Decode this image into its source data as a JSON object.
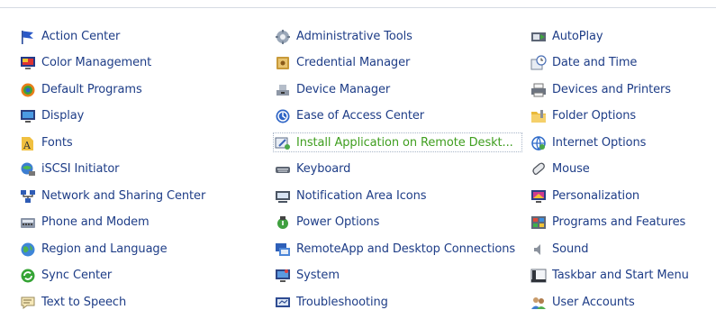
{
  "top_border_color": "#d6dbe3",
  "columns": [
    {
      "items": [
        {
          "label": "Action Center",
          "icon": "flag-icon"
        },
        {
          "label": "Color Management",
          "icon": "monitor-color-icon"
        },
        {
          "label": "Default Programs",
          "icon": "default-programs-icon"
        },
        {
          "label": "Display",
          "icon": "display-icon"
        },
        {
          "label": "Fonts",
          "icon": "fonts-icon"
        },
        {
          "label": "iSCSI Initiator",
          "icon": "iscsi-icon"
        },
        {
          "label": "Network and Sharing Center",
          "icon": "network-icon"
        },
        {
          "label": "Phone and Modem",
          "icon": "phone-modem-icon"
        },
        {
          "label": "Region and Language",
          "icon": "globe-icon"
        },
        {
          "label": "Sync Center",
          "icon": "sync-icon"
        },
        {
          "label": "Text to Speech",
          "icon": "speech-icon"
        }
      ]
    },
    {
      "items": [
        {
          "label": "Administrative Tools",
          "icon": "admin-tools-icon"
        },
        {
          "label": "Credential Manager",
          "icon": "credential-icon"
        },
        {
          "label": "Device Manager",
          "icon": "device-manager-icon"
        },
        {
          "label": "Ease of Access Center",
          "icon": "ease-of-access-icon"
        },
        {
          "label": "Install Application on Remote Deskt...",
          "icon": "install-app-icon",
          "selected": true
        },
        {
          "label": "Keyboard",
          "icon": "keyboard-icon"
        },
        {
          "label": "Notification Area Icons",
          "icon": "notification-icon"
        },
        {
          "label": "Power Options",
          "icon": "power-icon"
        },
        {
          "label": "RemoteApp and Desktop Connections",
          "icon": "remoteapp-icon"
        },
        {
          "label": "System",
          "icon": "system-icon"
        },
        {
          "label": "Troubleshooting",
          "icon": "troubleshooting-icon"
        }
      ]
    },
    {
      "items": [
        {
          "label": "AutoPlay",
          "icon": "autoplay-icon"
        },
        {
          "label": "Date and Time",
          "icon": "clock-icon"
        },
        {
          "label": "Devices and Printers",
          "icon": "printer-icon"
        },
        {
          "label": "Folder Options",
          "icon": "folder-icon"
        },
        {
          "label": "Internet Options",
          "icon": "internet-icon"
        },
        {
          "label": "Mouse",
          "icon": "mouse-icon"
        },
        {
          "label": "Personalization",
          "icon": "personalization-icon"
        },
        {
          "label": "Programs and Features",
          "icon": "programs-icon"
        },
        {
          "label": "Sound",
          "icon": "speaker-icon"
        },
        {
          "label": "Taskbar and Start Menu",
          "icon": "taskbar-icon"
        },
        {
          "label": "User Accounts",
          "icon": "users-icon"
        }
      ]
    }
  ]
}
